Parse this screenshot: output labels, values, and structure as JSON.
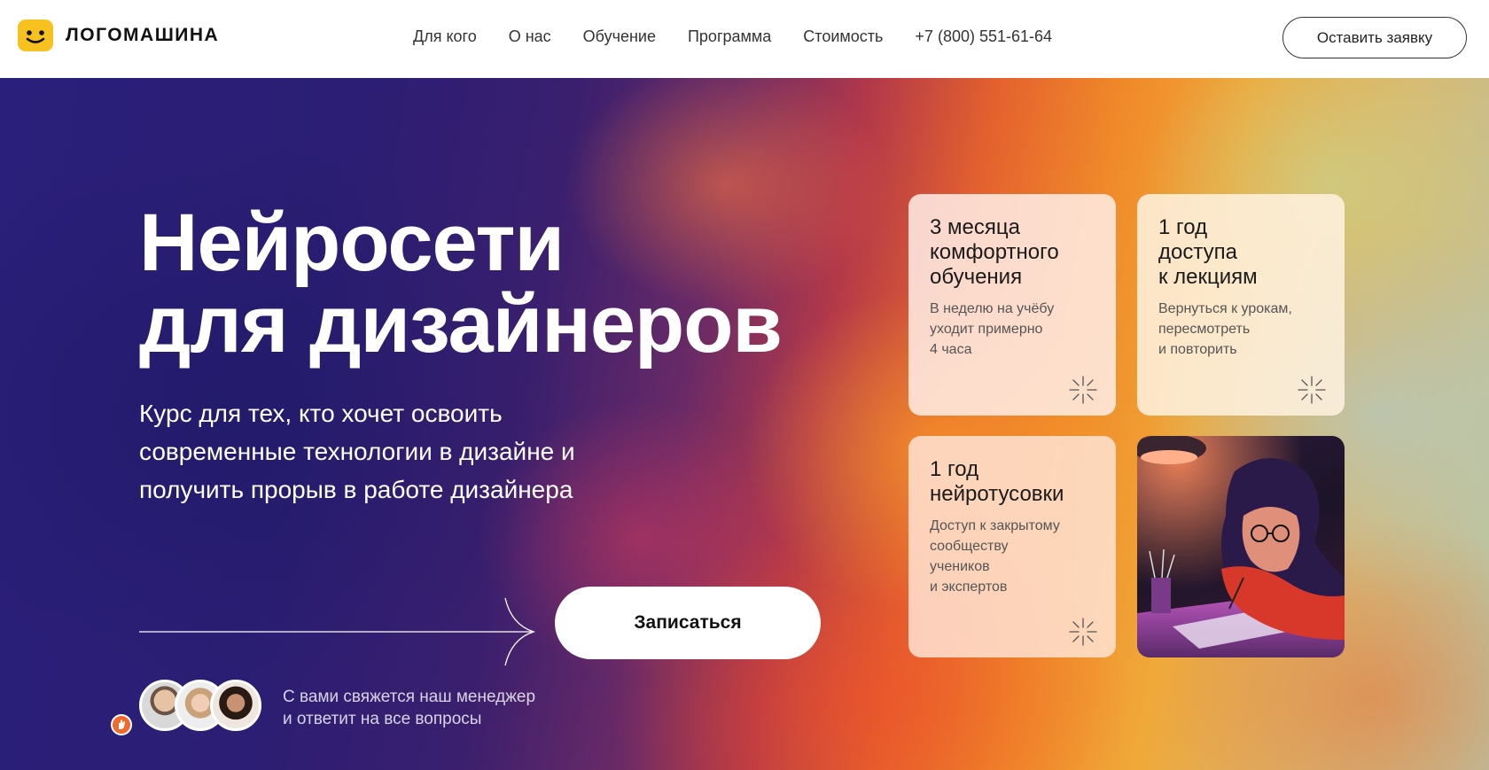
{
  "header": {
    "logo_text": "ЛОГОМАШИНА",
    "nav": [
      "Для кого",
      "О нас",
      "Обучение",
      "Программа",
      "Стоимость"
    ],
    "phone": "+7 (800) 551-61-64",
    "cta_label": "Оставить заявку"
  },
  "hero": {
    "title_line1": "Нейросети",
    "title_line2": "для дизайнеров",
    "subtitle": "Курс для тех, кто хочет освоить современные технологии в дизайне и получить прорыв в работе дизайнера",
    "enroll_label": "Записаться",
    "contact_line1": "С вами свяжется наш менеджер",
    "contact_line2": "и ответит на все вопросы"
  },
  "cards": [
    {
      "title_lines": [
        "3 месяца",
        "комфортного",
        "обучения"
      ],
      "text_lines": [
        "В неделю на учёбу",
        "уходит примерно",
        "4 часа"
      ]
    },
    {
      "title_lines": [
        "1 год",
        "доступа",
        "к лекциям"
      ],
      "text_lines": [
        "Вернуться к урокам,",
        "пересмотреть",
        "и повторить"
      ]
    },
    {
      "title_lines": [
        "1 год",
        "нейротусовки"
      ],
      "text_lines": [
        "Доступ к закрытому",
        "сообществу",
        "учеников",
        "и экспертов"
      ]
    }
  ],
  "colors": {
    "logo_yellow": "#f7c11f",
    "badge_orange": "#f06a2b"
  }
}
